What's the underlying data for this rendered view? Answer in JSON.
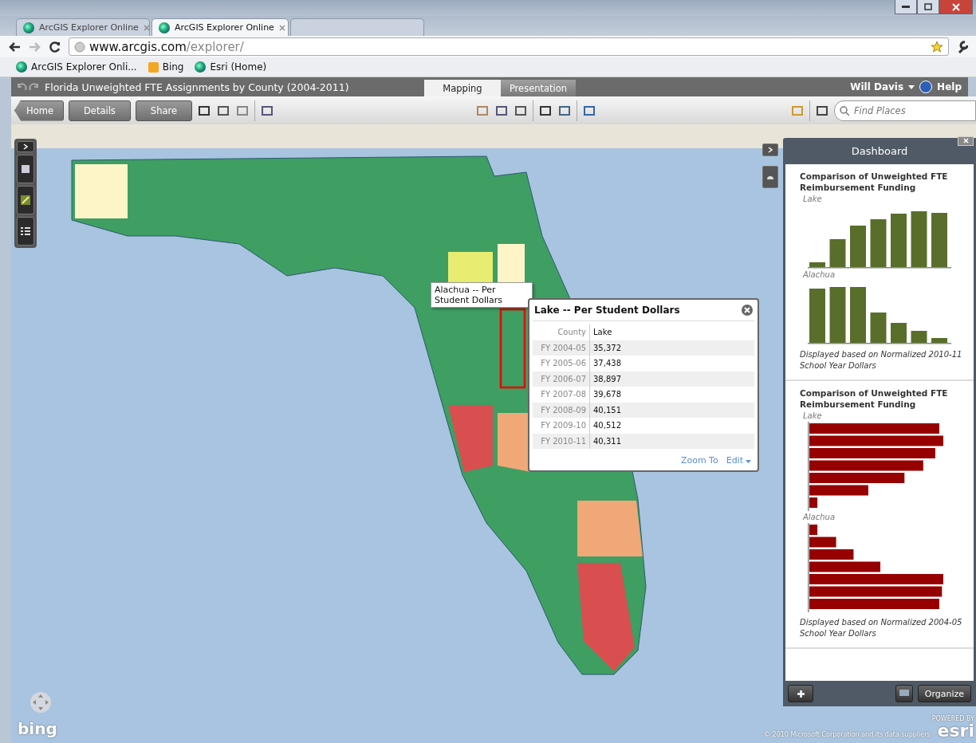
{
  "browser": {
    "tabs": [
      {
        "title": "ArcGIS Explorer Online",
        "selected": false
      },
      {
        "title": "ArcGIS Explorer Online",
        "selected": true
      },
      {
        "selected": false
      }
    ],
    "url": {
      "host": "www.arcgis.com",
      "path": "/explorer/"
    },
    "bookmarks": [
      {
        "label": "ArcGIS Explorer Onli...",
        "kind": "globe"
      },
      {
        "label": "Bing",
        "kind": "bing"
      },
      {
        "label": "Esri (Home)",
        "kind": "earth"
      }
    ]
  },
  "app": {
    "title": "Florida Unweighted FTE Assignments by County (2004-2011)",
    "view_tabs": [
      {
        "label": "Mapping",
        "selected": true
      },
      {
        "label": "Presentation",
        "selected": false
      }
    ],
    "user": "Will Davis",
    "help": "Help",
    "nav_buttons": [
      "Home",
      "Details",
      "Share"
    ],
    "search": {
      "placeholder": "Find Places"
    }
  },
  "map": {
    "tooltip": "Alachua -- Per Student Dollars",
    "logo": "bing",
    "attribution": "© 2010 Microsoft Corporation and its data suppliers",
    "esri_badge": {
      "caption": "POWERED BY",
      "name": "esri"
    }
  },
  "popup": {
    "title": "Lake -- Per Student Dollars",
    "rows": [
      {
        "label": "County",
        "value": "Lake"
      },
      {
        "label": "FY 2004-05",
        "value": "35,372"
      },
      {
        "label": "FY 2005-06",
        "value": "37,438"
      },
      {
        "label": "FY 2006-07",
        "value": "38,897"
      },
      {
        "label": "FY 2007-08",
        "value": "39,678"
      },
      {
        "label": "FY 2008-09",
        "value": "40,151"
      },
      {
        "label": "FY 2009-10",
        "value": "40,512"
      },
      {
        "label": "FY 2010-11",
        "value": "40,311"
      }
    ],
    "actions": [
      "Zoom To",
      "Edit"
    ]
  },
  "dashboard": {
    "title": "Dashboard",
    "organize": "Organize",
    "panels": [
      {
        "title": "Comparison of Unweighted FTE Reimbursement Funding",
        "kind": "column",
        "groups": [
          "Lake",
          "Alachua"
        ],
        "note": "Displayed based on Normalized 2010-11 School Year Dollars"
      },
      {
        "title": "Comparison of Unweighted FTE Reimbursement Funding",
        "kind": "bar",
        "groups": [
          "Lake",
          "Alachua"
        ],
        "note": "Displayed based on Normalized 2004-05 School Year Dollars"
      }
    ]
  }
}
